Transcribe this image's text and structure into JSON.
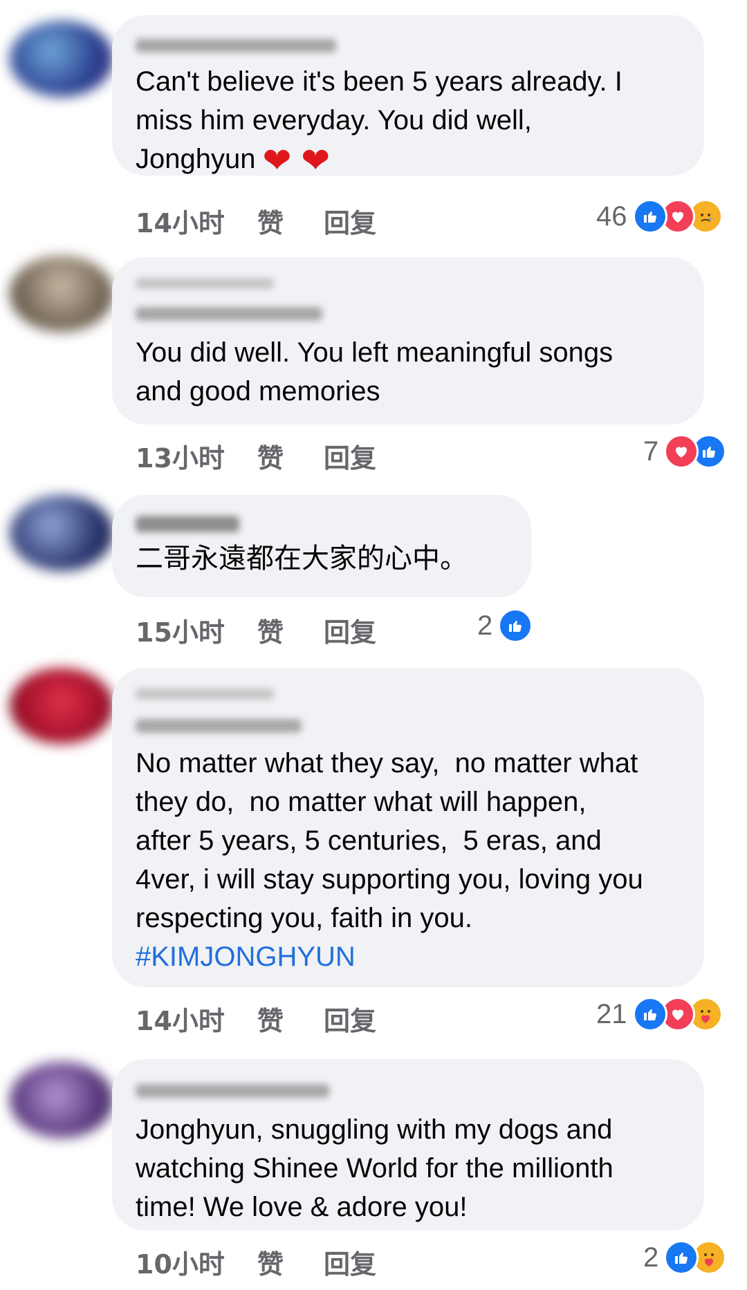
{
  "comments": [
    {
      "text": "Can't believe it's been 5 years already. I\nmiss him everyday. You did well,\nJonghyun",
      "trailing_emoji": "❤ ❤",
      "time": "14小时",
      "like": "赞",
      "reply": "回复",
      "reaction_count": "46",
      "reactions": [
        "like-icon",
        "love-icon",
        "sad-icon"
      ]
    },
    {
      "text": "You did well. You left meaningful songs\nand good memories",
      "time": "13小时",
      "like": "赞",
      "reply": "回复",
      "reaction_count": "7",
      "reactions": [
        "love-icon",
        "like-icon"
      ]
    },
    {
      "text": "二哥永遠都在大家的心中。",
      "time": "15小时",
      "like": "赞",
      "reply": "回复",
      "reaction_count": "2",
      "reactions": [
        "like-icon"
      ]
    },
    {
      "text": "No matter what they say,  no matter what\nthey do,  no matter what will happen,\nafter 5 years, 5 centuries,  5 eras, and\n4ver, i will stay supporting you, loving you\nrespecting you, faith in you.",
      "hashtag": "#KIMJONGHYUN",
      "time": "14小时",
      "like": "赞",
      "reply": "回复",
      "reaction_count": "21",
      "reactions": [
        "like-icon",
        "love-icon",
        "care-icon"
      ]
    },
    {
      "text": "Jonghyun, snuggling with my dogs and\nwatching Shinee World for the millionth\ntime! We love & adore you!",
      "time": "10小时",
      "like": "赞",
      "reply": "回复",
      "reaction_count": "2",
      "reactions": [
        "like-icon",
        "care-icon"
      ]
    }
  ],
  "colors": {
    "bubble": "#f0f2f5",
    "meta_text": "#65676b",
    "hashtag": "#216fdb",
    "like": "#1877f2",
    "love": "#f33e58",
    "sad": "#f7b125"
  }
}
